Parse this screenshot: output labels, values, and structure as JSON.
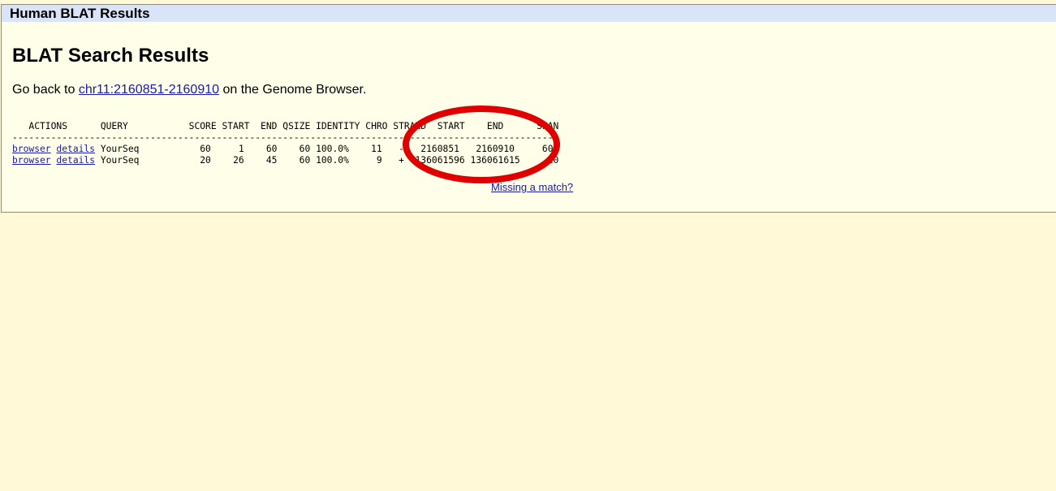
{
  "window": {
    "title": "Human BLAT Results"
  },
  "page": {
    "heading": "BLAT Search Results",
    "go_back_prefix": "Go back to ",
    "go_back_link": "chr11:2160851-2160910",
    "go_back_suffix": " on the Genome Browser."
  },
  "table": {
    "header": "   ACTIONS      QUERY           SCORE START  END QSIZE IDENTITY CHRO STRAND  START    END      SPAN",
    "separator": "---------------------------------------------------------------------------------------------------",
    "rows": [
      {
        "browser": "browser",
        "details": "details",
        "text": " YourSeq           60     1    60    60 100.0%    11   -   2160851   2160910     60"
      },
      {
        "browser": "browser",
        "details": "details",
        "text": " YourSeq           20    26    45    60 100.0%     9   +  136061596 136061615     20"
      }
    ]
  },
  "footer": {
    "missing_link": "Missing a match?"
  },
  "colors": {
    "page_background": "#fff9d7",
    "panel_background": "#fffee8",
    "titlebar_background": "#d9e4f8",
    "link": "#1a1aa6",
    "annotation_circle": "#e00000"
  }
}
